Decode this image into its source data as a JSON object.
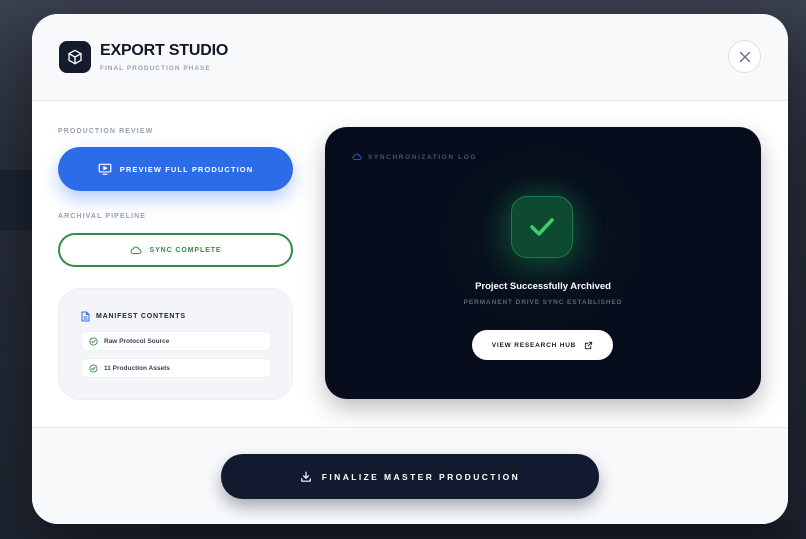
{
  "header": {
    "title": "EXPORT STUDIO",
    "subtitle": "FINAL PRODUCTION PHASE"
  },
  "production_review": {
    "label": "PRODUCTION REVIEW",
    "preview_button": "PREVIEW FULL PRODUCTION"
  },
  "archival_pipeline": {
    "label": "ARCHIVAL PIPELINE",
    "sync_button": "SYNC COMPLETE"
  },
  "manifest": {
    "title": "MANIFEST CONTENTS",
    "items": [
      {
        "label": "Raw Protocol Source"
      },
      {
        "label": "11 Production Assets"
      }
    ]
  },
  "sync_log": {
    "title": "SYNCHRONIZATION LOG",
    "headline": "Project Successfully Archived",
    "subline": "PERMANENT DRIVE SYNC ESTABLISHED",
    "hub_button": "VIEW RESEARCH HUB"
  },
  "footer": {
    "finalize_button": "FINALIZE MASTER PRODUCTION"
  },
  "colors": {
    "accent_blue": "#2d6ce8",
    "success_green": "#2f8f46",
    "dark_navy": "#111a2e",
    "log_panel": "#070d1c"
  },
  "icons": {
    "logo": "cube-icon",
    "close": "close-icon",
    "preview": "monitor-play-icon",
    "sync": "cloud-icon",
    "manifest": "document-icon",
    "manifest_item": "check-circle-icon",
    "log": "cloud-icon",
    "success": "checkmark-icon",
    "hub": "external-link-icon",
    "finalize": "download-icon"
  }
}
